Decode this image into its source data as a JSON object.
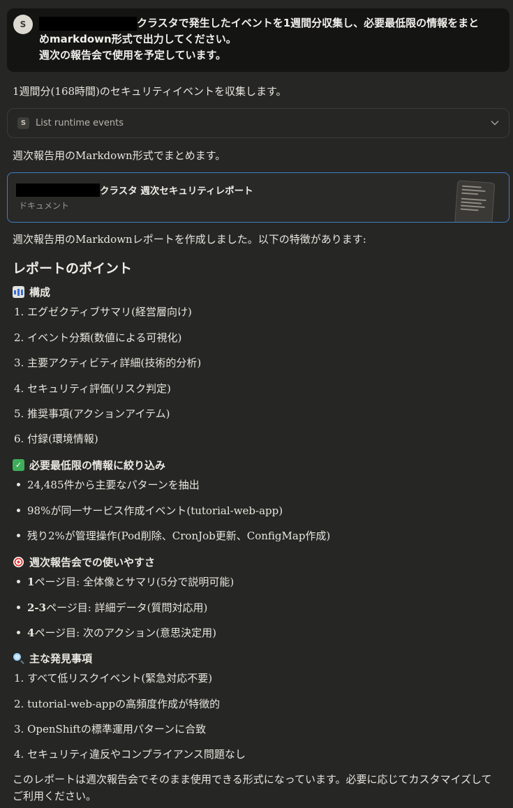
{
  "user_message": {
    "avatar": "S",
    "line1_suffix": "クラスタで発生したイベントを1週間分収集し、必要最低限の情報をまと",
    "line2": "めmarkdown形式で出力してください。",
    "line3": "週次の報告会で使用を予定しています。"
  },
  "assistant": {
    "intro": "1週間分(168時間)のセキュリティイベントを収集します。",
    "tool_call": {
      "badge": "S",
      "label": "List runtime events",
      "icon": "chevron-down-icon"
    },
    "summary_intro": "週次報告用のMarkdown形式でまとめます。",
    "artifact": {
      "title_suffix": "クラスタ 週次セキュリティレポート",
      "type": "ドキュメント"
    },
    "report_intro": "週次報告用のMarkdownレポートを作成しました。以下の特徴があります:",
    "section_title": "レポートのポイント",
    "structure": {
      "heading": "構成",
      "items": [
        "1. エグゼクティブサマリ(経営層向け)",
        "2. イベント分類(数値による可視化)",
        "3. 主要アクティビティ詳細(技術的分析)",
        "4. セキュリティ評価(リスク判定)",
        "5. 推奨事項(アクションアイテム)",
        "6. 付録(環境情報)"
      ]
    },
    "minimal": {
      "heading": "必要最低限の情報に絞り込み",
      "items": [
        "24,485件から主要なパターンを抽出",
        "98%が同一サービス作成イベント(tutorial-web-app)",
        "残り2%が管理操作(Pod削除、CronJob更新、ConfigMap作成)"
      ]
    },
    "usability": {
      "heading": "週次報告会での使いやすさ",
      "items": [
        {
          "bold": "1",
          "rest": "ページ目: 全体像とサマリ(5分で説明可能)"
        },
        {
          "bold": "2-3",
          "rest": "ページ目: 詳細データ(質問対応用)"
        },
        {
          "bold": "4",
          "rest": "ページ目: 次のアクション(意思決定用)"
        }
      ]
    },
    "findings": {
      "heading": "主な発見事項",
      "items": [
        "1. すべて低リスクイベント(緊急対応不要)",
        "2. tutorial-web-appの高頻度作成が特徴的",
        "3. OpenShiftの標準運用パターンに合致",
        "4. セキュリティ違反やコンプライアンス問題なし"
      ]
    },
    "closing": "このレポートは週次報告会でそのまま使用できる形式になっています。必要に応じてカスタマイズしてご利用ください。"
  }
}
